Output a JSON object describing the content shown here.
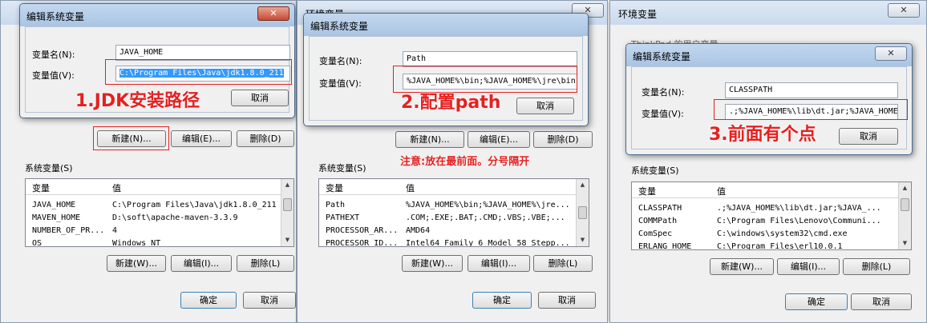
{
  "panel1": {
    "dialog_title": "编辑系统变量",
    "name_label": "变量名(N):",
    "name_value": "JAVA_HOME",
    "value_label": "变量值(V):",
    "value_value": "C:\\Program Files\\Java\\jdk1.8.0_211",
    "annotation": "1.JDK安装路径",
    "cancel": "取消",
    "user_buttons": {
      "new": "新建(N)...",
      "edit": "编辑(E)...",
      "delete": "删除(D)"
    },
    "system_vars_label": "系统变量(S)",
    "columns": [
      "变量",
      "值"
    ],
    "rows": [
      [
        "JAVA_HOME",
        "C:\\Program Files\\Java\\jdk1.8.0_211"
      ],
      [
        "MAVEN_HOME",
        "D:\\soft\\apache-maven-3.3.9"
      ],
      [
        "NUMBER_OF_PR...",
        "4"
      ],
      [
        "OS",
        "Windows_NT"
      ]
    ],
    "sys_buttons": {
      "new": "新建(W)...",
      "edit": "编辑(I)...",
      "delete": "删除(L)"
    },
    "ok": "确定",
    "bottom_cancel": "取消"
  },
  "panel2": {
    "window_title": "环境变量",
    "dialog_title": "编辑系统变量",
    "name_label": "变量名(N):",
    "name_value": "Path",
    "value_label": "变量值(V):",
    "value_value": "%JAVA_HOME%\\bin;%JAVA_HOME%\\jre\\bin",
    "annotation": "2.配置path",
    "note": "注意:放在最前面。分号隔开",
    "cancel": "取消",
    "user_buttons": {
      "new": "新建(N)...",
      "edit": "编辑(E)...",
      "delete": "删除(D)"
    },
    "system_vars_label": "系统变量(S)",
    "columns": [
      "变量",
      "值"
    ],
    "rows": [
      [
        "Path",
        "%JAVA_HOME%\\bin;%JAVA_HOME%\\jre..."
      ],
      [
        "PATHEXT",
        ".COM;.EXE;.BAT;.CMD;.VBS;.VBE;..."
      ],
      [
        "PROCESSOR_AR...",
        "AMD64"
      ],
      [
        "PROCESSOR_ID...",
        "Intel64 Family 6 Model 58 Stepp..."
      ]
    ],
    "sys_buttons": {
      "new": "新建(W)...",
      "edit": "编辑(I)...",
      "delete": "删除(L)"
    },
    "ok": "确定",
    "bottom_cancel": "取消"
  },
  "panel3": {
    "window_title": "环境变量",
    "user_vars_label": "ThinkPad 的用户变量",
    "dialog_title": "编辑系统变量",
    "name_label": "变量名(N):",
    "name_value": "CLASSPATH",
    "value_label": "变量值(V):",
    "value_value": ".;%JAVA_HOME%\\lib\\dt.jar;%JAVA_HOME%",
    "annotation": "3.前面有个点",
    "cancel": "取消",
    "system_vars_label": "系统变量(S)",
    "columns": [
      "变量",
      "值"
    ],
    "rows": [
      [
        "CLASSPATH",
        ".;%JAVA_HOME%\\lib\\dt.jar;%JAVA_..."
      ],
      [
        "COMMPath",
        "C:\\Program Files\\Lenovo\\Communi..."
      ],
      [
        "ComSpec",
        "C:\\windows\\system32\\cmd.exe"
      ],
      [
        "ERLANG_HOME",
        "C:\\Program Files\\erl10.0.1"
      ]
    ],
    "sys_buttons": {
      "new": "新建(W)...",
      "edit": "编辑(I)...",
      "delete": "删除(L)"
    },
    "ok": "确定",
    "bottom_cancel": "取消"
  },
  "colors": {
    "annotation": "#e52020",
    "selection": "#3399ff",
    "title_bar": "#b9cfe8"
  }
}
